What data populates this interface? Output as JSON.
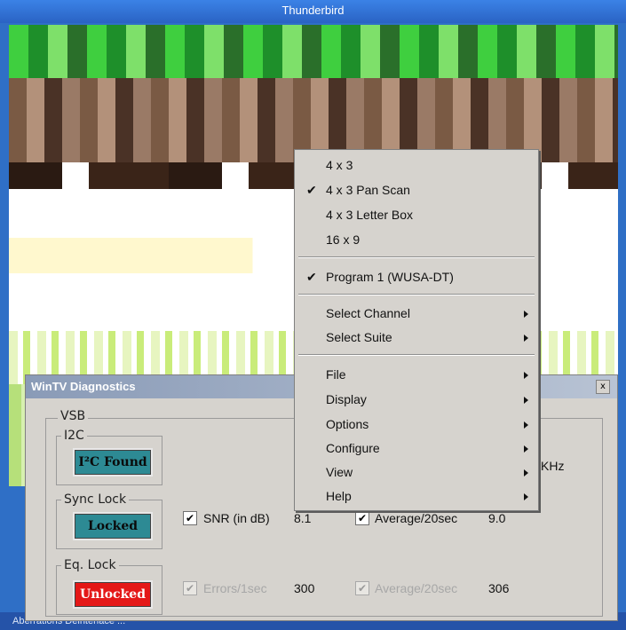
{
  "window": {
    "title": "Thunderbird"
  },
  "context_menu": {
    "aspect_items": [
      {
        "label": "4 x 3",
        "checked": false
      },
      {
        "label": "4 x 3 Pan Scan",
        "checked": true
      },
      {
        "label": "4 x 3 Letter Box",
        "checked": false
      },
      {
        "label": "16 x 9",
        "checked": false
      }
    ],
    "program_item": {
      "label": "Program 1 (WUSA-DT)",
      "checked": true
    },
    "select_items": [
      {
        "label": "Select Channel",
        "submenu": true
      },
      {
        "label": "Select Suite",
        "submenu": true
      }
    ],
    "main_items": [
      {
        "label": "File",
        "submenu": true
      },
      {
        "label": "Display",
        "submenu": true
      },
      {
        "label": "Options",
        "submenu": true
      },
      {
        "label": "Configure",
        "submenu": true
      },
      {
        "label": "View",
        "submenu": true
      },
      {
        "label": "Help",
        "submenu": true
      }
    ],
    "check_glyph": "✔"
  },
  "diagnostics": {
    "title": "WinTV Diagnostics",
    "close_glyph": "x",
    "vsb_label": "VSB",
    "i2c": {
      "label": "I2C",
      "status": "I²C Found"
    },
    "sync_lock": {
      "label": "Sync Lock",
      "status": "Locked"
    },
    "eq_lock": {
      "label": "Eq. Lock",
      "status": "Unlocked"
    },
    "freq_unit_partial": "KHz",
    "snr": {
      "label": "SNR (in dB)",
      "value": "8.1",
      "checked": true
    },
    "snr_avg": {
      "label": "Average/20sec",
      "value": "9.0",
      "checked": true
    },
    "errors": {
      "label": "Errors/1sec",
      "value": "300",
      "checked": true,
      "disabled": true
    },
    "errors_avg": {
      "label": "Average/20sec",
      "value": "306",
      "checked": true,
      "disabled": true
    }
  },
  "taskbar": {
    "text": "Aberrations  Deinterlace  ..."
  },
  "colors": {
    "status_ok": "#2d8a94",
    "status_bad": "#e41818",
    "menu_bg": "#d6d3ce",
    "title_blue": "#2a63c4"
  }
}
